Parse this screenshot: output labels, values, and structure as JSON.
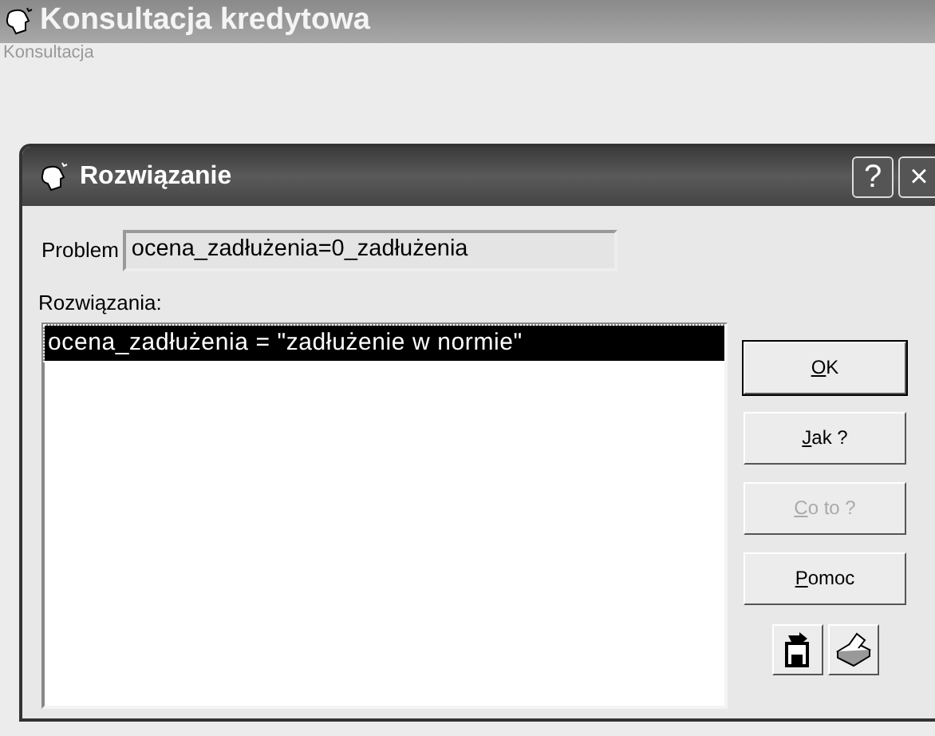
{
  "window": {
    "title": "Konsultacja kredytowa"
  },
  "menu": [
    "Konsultacja"
  ],
  "dialog": {
    "title": "Rozwiązanie",
    "problem": {
      "label": "Problem",
      "value": "ocena_zadłużenia=0_zadłużenia"
    },
    "solutions_label": "Rozwiązania:",
    "solutions": [
      {
        "text": "ocena_zadłużenia = \"zadłużenie w normie\"",
        "selected": true
      }
    ],
    "buttons": [
      {
        "access_key": "O",
        "rest": "K",
        "default": true,
        "disabled": false
      },
      {
        "access_key": "J",
        "rest": "ak ?",
        "default": false,
        "disabled": false
      },
      {
        "access_key": "C",
        "rest": "o to ?",
        "default": false,
        "disabled": true
      },
      {
        "access_key": "P",
        "rest": "omoc",
        "default": false,
        "disabled": false
      }
    ],
    "help_glyph": "?",
    "close_glyph": "×"
  }
}
